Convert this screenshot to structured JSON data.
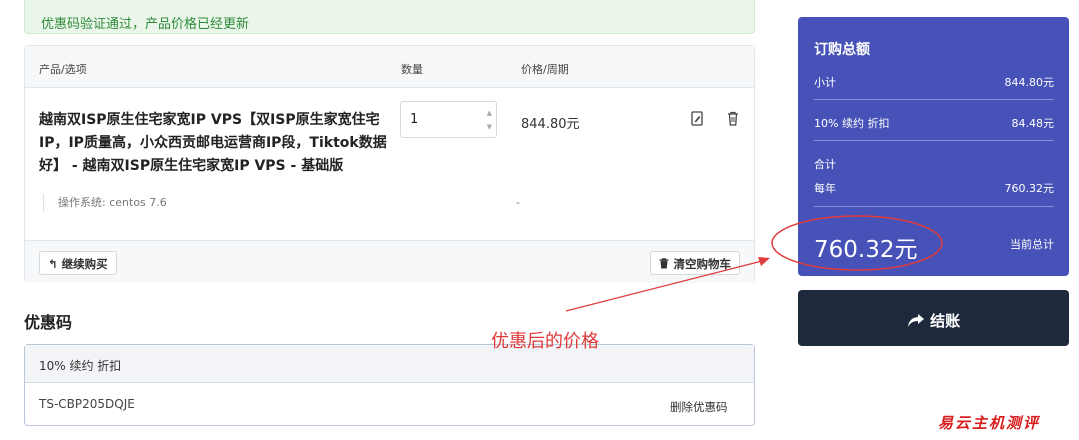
{
  "alert": {
    "text": "优惠码验证通过，产品价格已经更新"
  },
  "cart": {
    "headers": {
      "product": "产品/选项",
      "qty": "数量",
      "price": "价格/周期"
    },
    "item": {
      "name": "越南双ISP原生住宅家宽IP VPS【双ISP原生家宽住宅IP，IP质量高，小众西贡邮电运营商IP段，Tiktok数据好】 - 越南双ISP原生住宅家宽IP VPS - 基础版",
      "quantity": "1",
      "price": "844.80元",
      "option_label": "操作系统:",
      "option_value": "centos 7.6",
      "option_price": "-"
    },
    "continue_label": "继续购买",
    "empty_label": "清空购物车"
  },
  "coupon": {
    "title": "优惠码",
    "applied": "10% 续约 折扣",
    "code": "TS-CBP205DQJE",
    "remove_label": "删除优惠码"
  },
  "summary": {
    "title": "订购总额",
    "subtotal_label": "小计",
    "subtotal_value": "844.80元",
    "discount_label": "10% 续约 折扣",
    "discount_value": "84.48元",
    "total_label": "合计",
    "period_label": "每年",
    "period_value": "760.32元",
    "grand_total": "760.32元",
    "grand_total_label": "当前总计"
  },
  "checkout": {
    "label": "结账"
  },
  "annotation": {
    "text": "优惠后的价格",
    "color": "#e03a3a"
  },
  "watermark": "易云主机测评",
  "colors": {
    "summary_bg": "#4752b8",
    "checkout_bg": "#1e2a3c",
    "alert_green": "#2e8b3a"
  }
}
